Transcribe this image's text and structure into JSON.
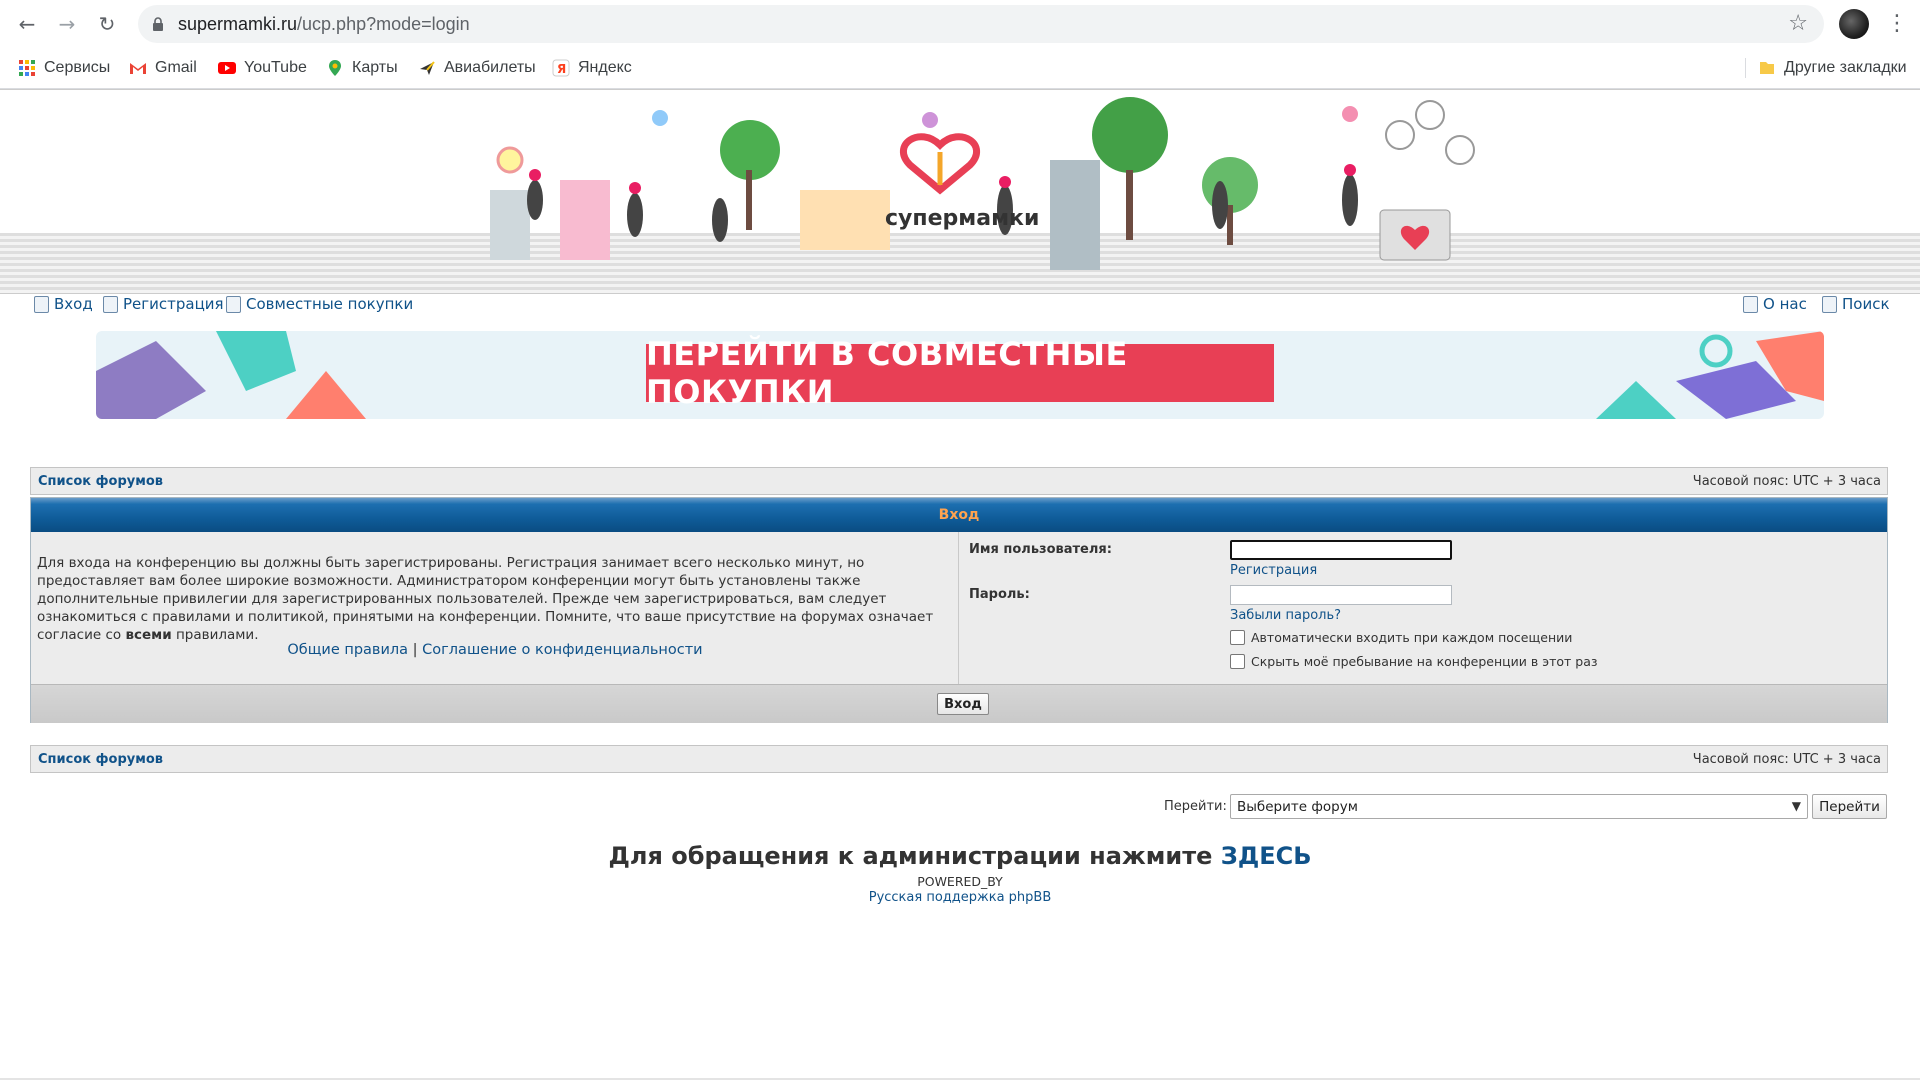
{
  "browser": {
    "url_host": "supermamki.ru",
    "url_path": "/ucp.php?mode=login"
  },
  "bookmarks": {
    "items": [
      {
        "label": "Сервисы",
        "icon": "apps-grid-icon"
      },
      {
        "label": "Gmail",
        "icon": "gmail-icon"
      },
      {
        "label": "YouTube",
        "icon": "youtube-icon"
      },
      {
        "label": "Карты",
        "icon": "maps-pin-icon"
      },
      {
        "label": "Авиабилеты",
        "icon": "airplane-icon"
      },
      {
        "label": "Яндекс",
        "icon": "yandex-icon"
      }
    ],
    "other": "Другие закладки"
  },
  "banner": {
    "logo_text": "супермамки"
  },
  "topnav": {
    "login": "Вход",
    "register": "Регистрация",
    "group_buy": "Совместные покупки",
    "about": "О нас",
    "search": "Поиск"
  },
  "promo": {
    "button": "ПЕРЕЙТИ В СОВМЕСТНЫЕ ПОКУПКИ"
  },
  "breadcrumb": {
    "forum_list": "Список форумов",
    "timezone": "Часовой пояс: UTC + 3 часа"
  },
  "login": {
    "title": "Вход",
    "intro_before_bold": "Для входа на конференцию вы должны быть зарегистрированы. Регистрация занимает всего несколько минут, но предоставляет вам более широкие возможности. Администратором конференции могут быть установлены также дополнительные привилегии для зарегистрированных пользователей. Прежде чем зарегистрироваться, вам следует ознакомиться с правилами и политикой, принятыми на конференции. Помните, что ваше присутствие на форумах означает согласие со ",
    "intro_bold": "всеми",
    "intro_after_bold": " правилами.",
    "rules_link": "Общие правила",
    "separator": "|",
    "privacy_link": "Соглашение о конфиденциальности",
    "username_label": "Имя пользователя:",
    "username_value": "",
    "register_link": "Регистрация",
    "password_label": "Пароль:",
    "password_value": "",
    "forgot_link": "Забыли пароль?",
    "autologin_label": "Автоматически входить при каждом посещении",
    "autologin_checked": false,
    "hide_label": "Скрыть моё пребывание на конференции в этот раз",
    "hide_checked": false,
    "submit": "Вход"
  },
  "jumpbox": {
    "label": "Перейти:",
    "selected": "Выберите форум",
    "button": "Перейти"
  },
  "footer": {
    "contact_text": "Для обращения к администрации нажмите ",
    "contact_link": "ЗДЕСЬ",
    "powered_by": "POWERED_BY",
    "phpbb": "Русская поддержка phpBB"
  },
  "colors": {
    "link": "#105289",
    "header_bar": "#0f5c99",
    "header_text": "#ffa34f",
    "promo_button": "#e83f55"
  }
}
